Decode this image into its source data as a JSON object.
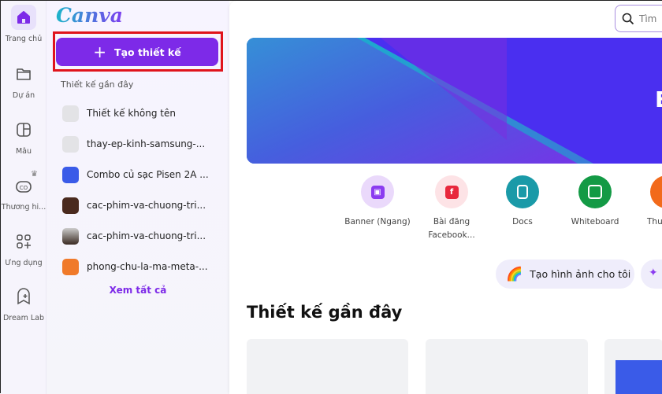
{
  "rail": {
    "items": [
      {
        "label": "Trang chủ",
        "icon": "home-icon"
      },
      {
        "label": "Dự án",
        "icon": "folder-icon"
      },
      {
        "label": "Mẫu",
        "icon": "template-icon"
      },
      {
        "label": "Thương hi...",
        "icon": "brand-icon"
      },
      {
        "label": "Ứng dụng",
        "icon": "apps-icon"
      },
      {
        "label": "Dream Lab",
        "icon": "dream-lab-icon"
      }
    ]
  },
  "panel": {
    "logo": "Canva",
    "create_label": "Tạo thiết kế",
    "recent_heading": "Thiết kế gần đây",
    "recent": [
      "Thiết kế không tên",
      "thay-ep-kinh-samsung-...",
      "Combo củ sạc Pisen 2A ...",
      "cac-phim-va-chuong-tri...",
      "cac-phim-va-chuong-tri...",
      "phong-chu-la-ma-meta-..."
    ],
    "see_all": "Xem tất cả"
  },
  "main": {
    "search_placeholder": "Tìm",
    "banner_text": "E",
    "shortcuts": [
      {
        "label": "Banner (Ngang)",
        "color": "#8b3cf0",
        "bg": "#ead9fb"
      },
      {
        "label": "Bài đăng Facebook...",
        "color": "#e8283d",
        "bg": "#fde3e6"
      },
      {
        "label": "Docs",
        "color": "#ffffff",
        "bg": "#1a9aa8"
      },
      {
        "label": "Whiteboard",
        "color": "#ffffff",
        "bg": "#139a45"
      },
      {
        "label": "Thuy",
        "color": "#ffffff",
        "bg": "#f26a1b"
      }
    ],
    "chip_label": "Tạo hình ảnh cho tôi",
    "recent_heading": "Thiết kế gần đây"
  },
  "colors": {
    "accent": "#7d2ae8",
    "highlight": "#e0141c"
  }
}
